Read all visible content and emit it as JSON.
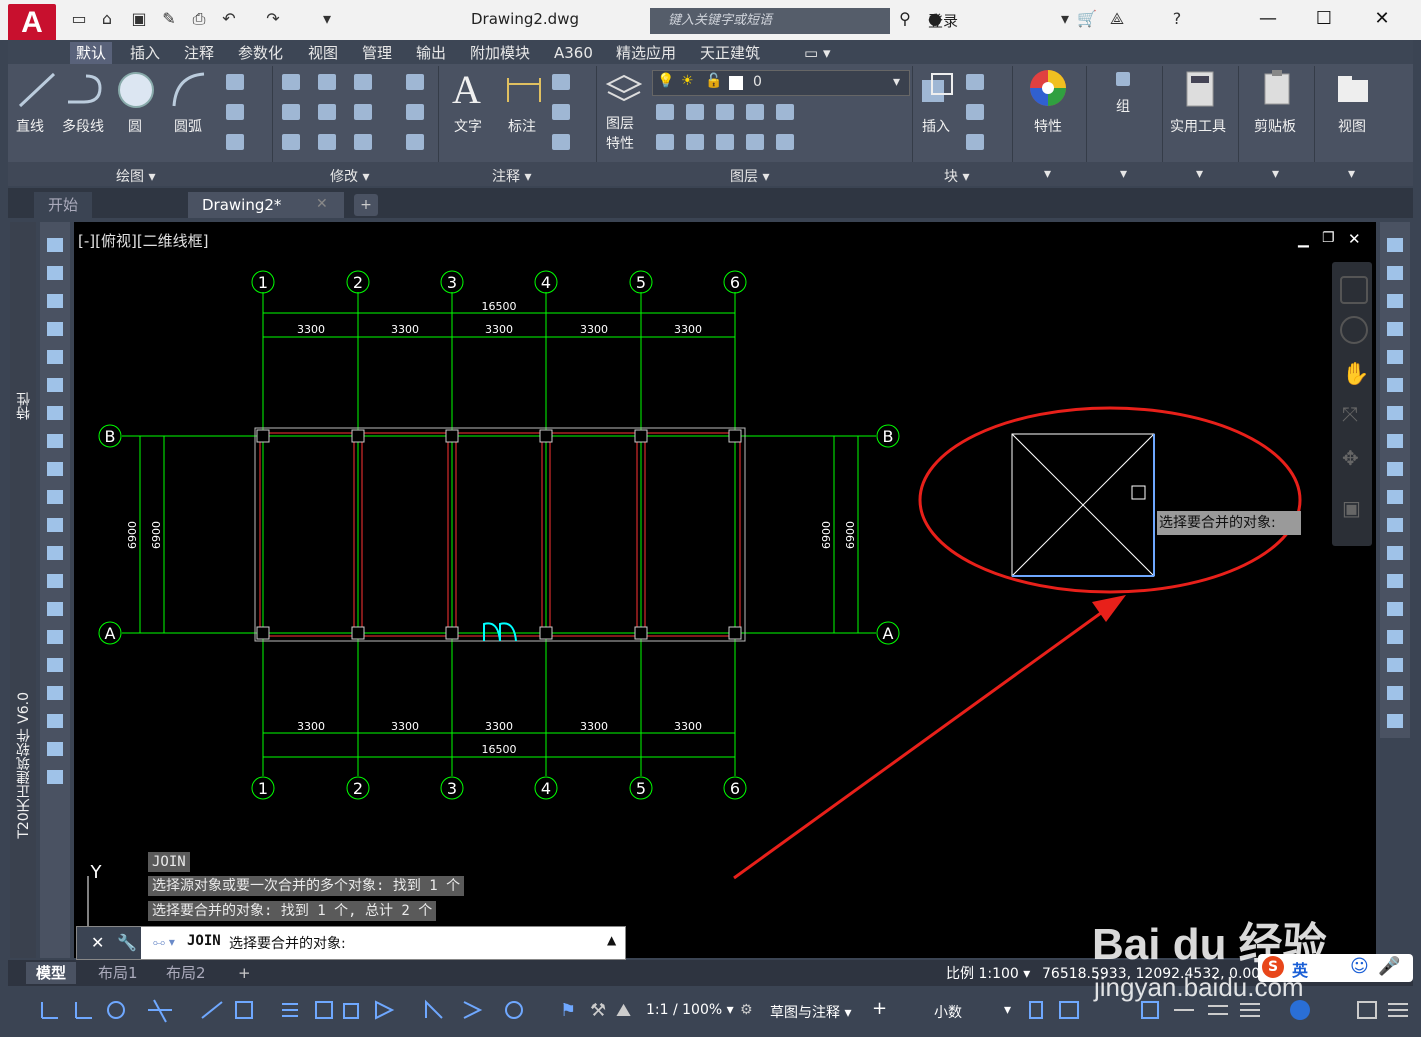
{
  "app": {
    "logo_letter": "A",
    "document_title": "Drawing2.dwg",
    "search_placeholder": "键入关键字或短语",
    "login_label": "登录"
  },
  "ribbon": {
    "tabs": [
      "默认",
      "插入",
      "注释",
      "参数化",
      "视图",
      "管理",
      "输出",
      "附加模块",
      "A360",
      "精选应用",
      "天正建筑"
    ],
    "active_tab": "默认",
    "draw_tools": [
      "直线",
      "多段线",
      "圆",
      "圆弧"
    ],
    "text_tools": [
      "文字",
      "标注"
    ],
    "layer_tool": "图层\n特性",
    "layer_tool_lines": [
      "图层",
      "特性"
    ],
    "layer_value": "0",
    "insert_tool": "插入",
    "properties_tool": "特性",
    "group_tool": "组",
    "utilities_tool": "实用工具",
    "clipboard_tool": "剪贴板",
    "view_tool": "视图",
    "panel_titles": [
      "绘图",
      "修改",
      "注释",
      "图层",
      "块"
    ]
  },
  "doc_tabs": {
    "start": "开始",
    "current": "Drawing2*"
  },
  "viewport": {
    "label": "[-][俯视][二维线框]"
  },
  "side_palette": {
    "properties_label": "特性",
    "tianzheng_label": "T20天正建筑软件 V6.0"
  },
  "drawing": {
    "grid_numbers": [
      "1",
      "2",
      "3",
      "4",
      "5",
      "6"
    ],
    "grid_letters_top": "B",
    "grid_letters_bottom": "A",
    "span_dims": [
      "3300",
      "3300",
      "3300",
      "3300",
      "3300"
    ],
    "total_dim": "16500",
    "bay_dim": "6900",
    "ucs_y": "Y"
  },
  "tooltip": "选择要合并的对象:",
  "command": {
    "history": [
      "JOIN",
      "选择源对象或要一次合并的多个对象: 找到 1 个",
      "选择要合并的对象: 找到 1 个, 总计 2 个"
    ],
    "prompt_cmd": "JOIN",
    "prompt_text": "选择要合并的对象:"
  },
  "layout_tabs": [
    "模型",
    "布局1",
    "布局2"
  ],
  "status": {
    "scale": "比例 1:100",
    "coords": "76518.5933, 12092.4532, 0.0000",
    "annotation_scale": "1:1 / 100%",
    "workspace": "草图与注释",
    "units": "小数"
  },
  "watermark": {
    "logo": "Bai du 经验",
    "url": "jingyan.baidu.com",
    "ime": "英"
  },
  "colors": {
    "canvas_bg": "#000000",
    "grid_green": "#00ff00",
    "wall_red": "#ff3333",
    "annotation_red": "#e8201a",
    "ribbon_bg": "#4a5262"
  }
}
